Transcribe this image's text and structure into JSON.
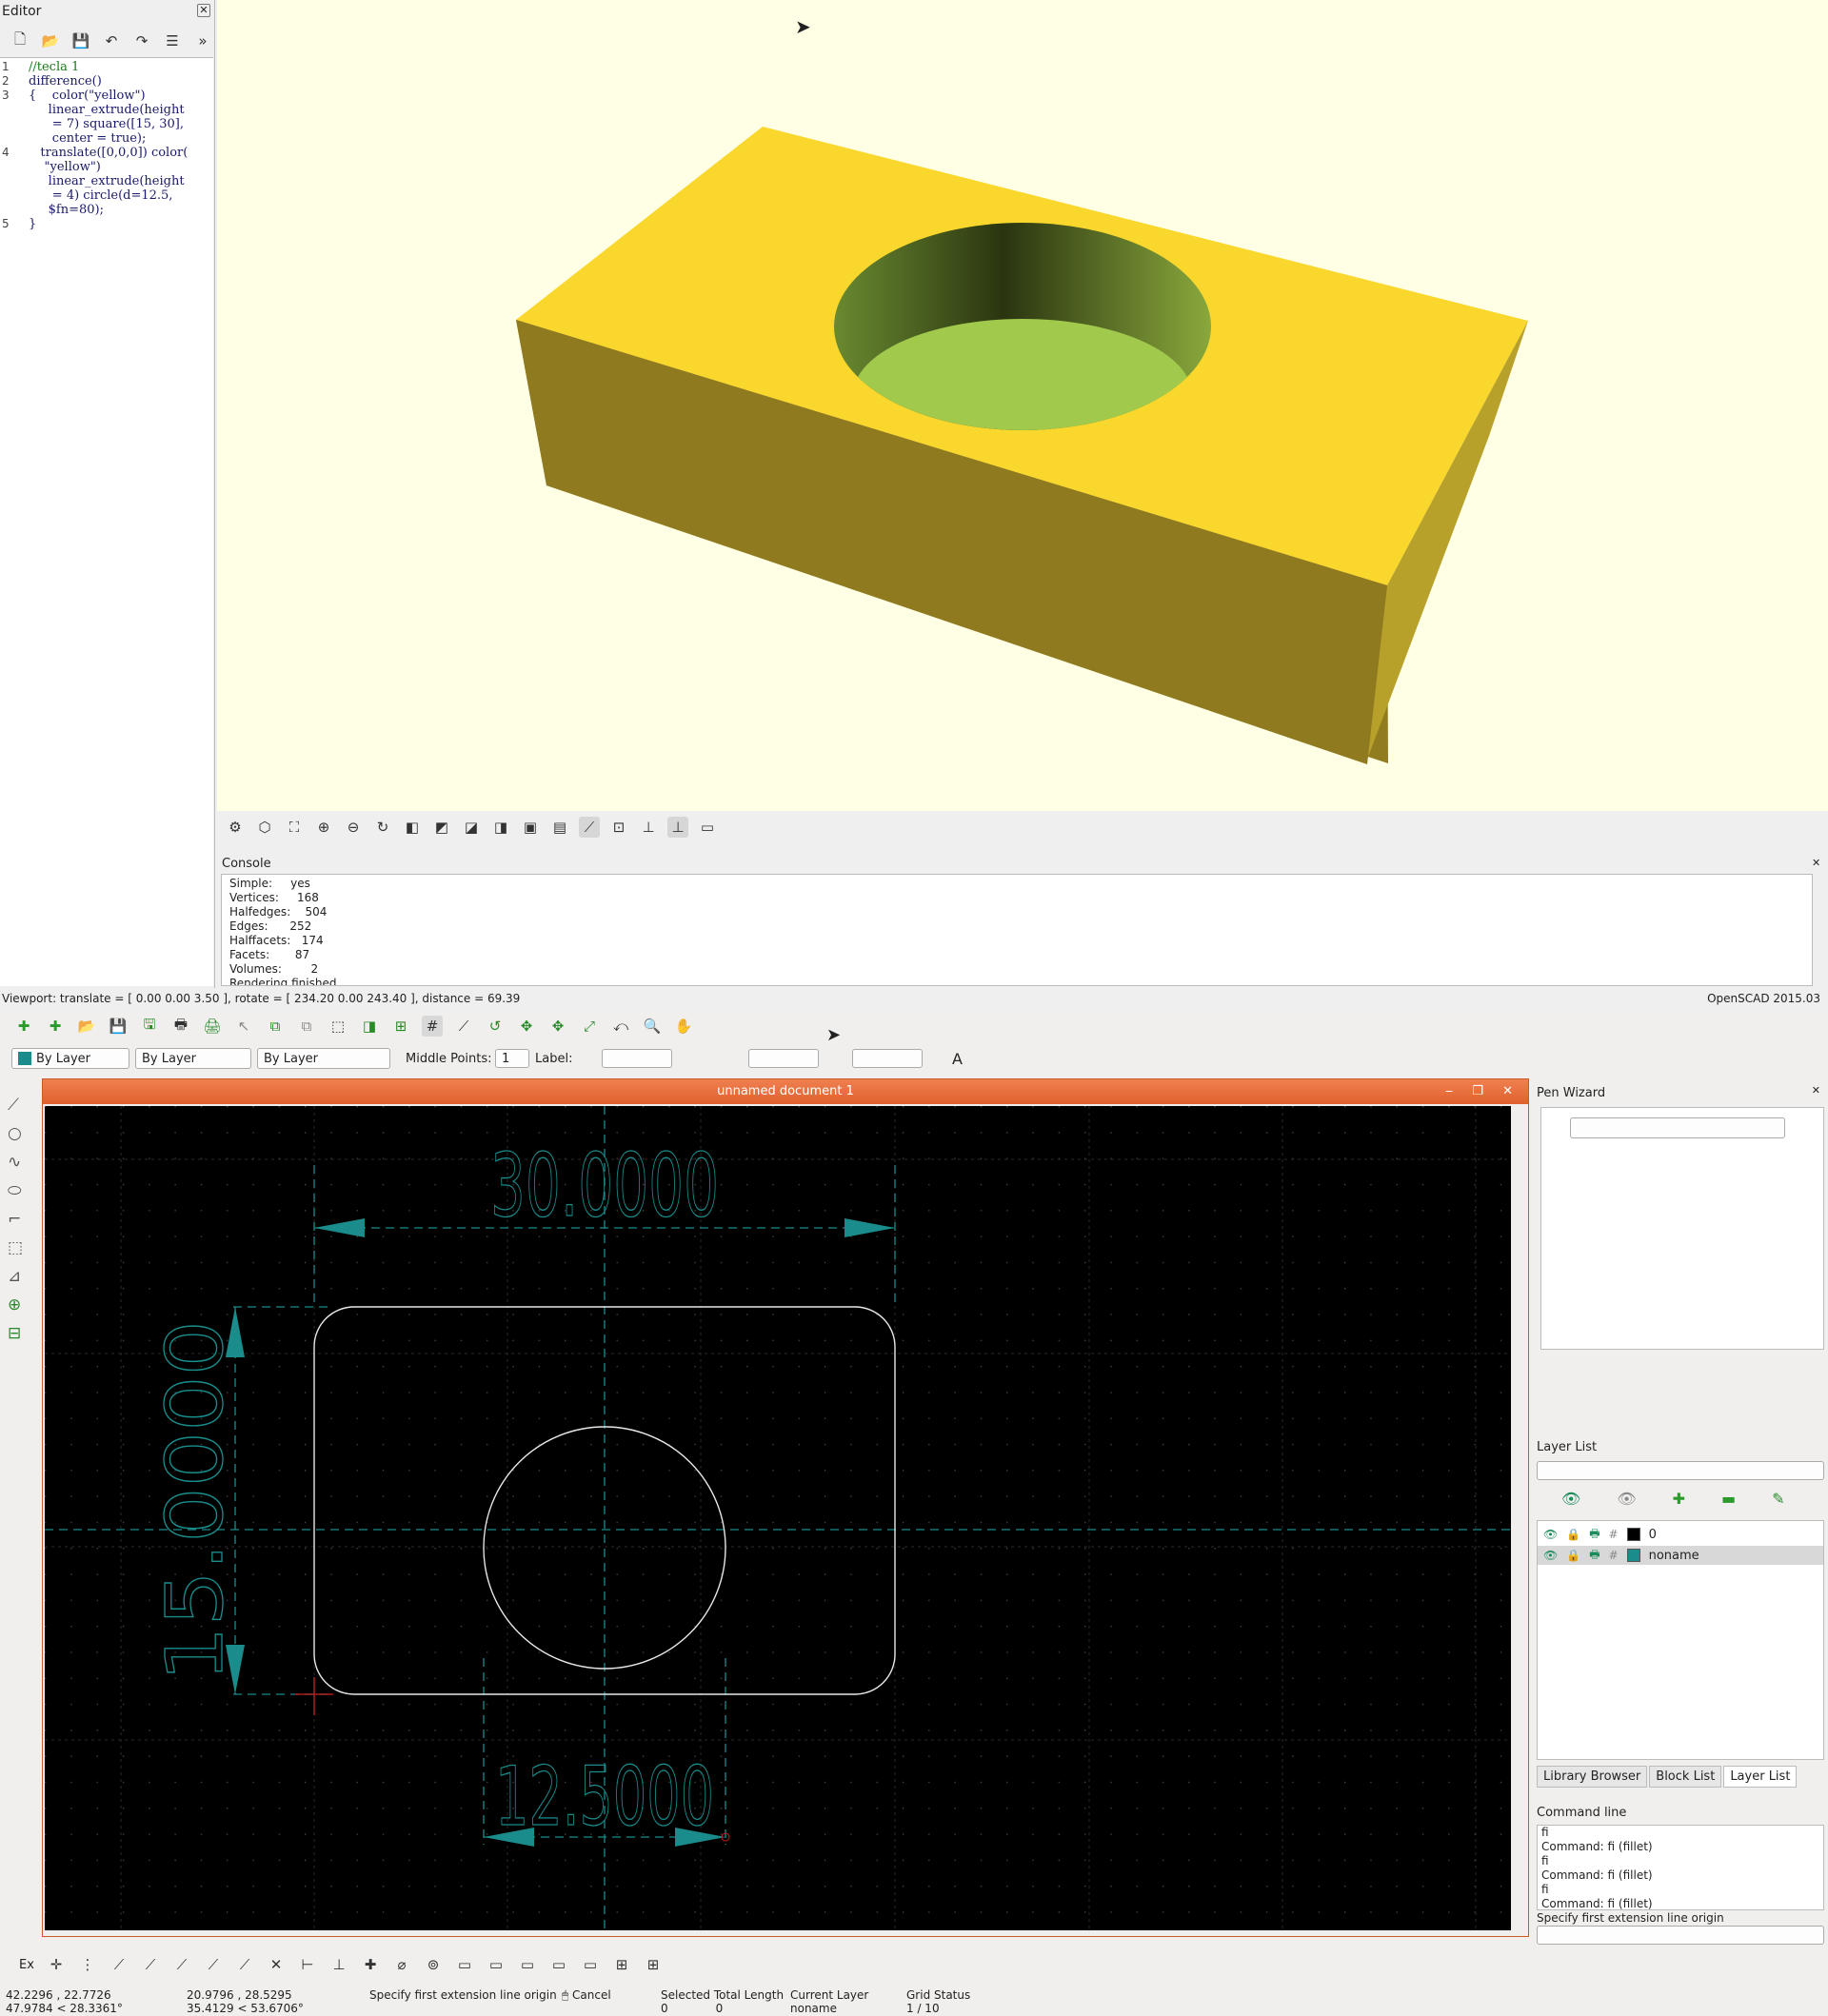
{
  "openscad": {
    "editor": {
      "title": "Editor",
      "code_lines": [
        {
          "num": "1",
          "text": "//tecla 1"
        },
        {
          "num": "2",
          "text": "difference()"
        },
        {
          "num": "3",
          "text": "{    color(\"yellow\")"
        },
        {
          "num": "",
          "text": "     linear_extrude(height"
        },
        {
          "num": "",
          "text": "      = 7) square([15, 30],"
        },
        {
          "num": "",
          "text": "      center = true);"
        },
        {
          "num": "4",
          "text": "   translate([0,0,0]) color("
        },
        {
          "num": "",
          "text": "    \"yellow\")"
        },
        {
          "num": "",
          "text": "     linear_extrude(height"
        },
        {
          "num": "",
          "text": "      = 4) circle(d=12.5,"
        },
        {
          "num": "",
          "text": "     $fn=80);"
        },
        {
          "num": "5",
          "text": "}"
        }
      ]
    },
    "console": {
      "title": "Console",
      "lines": [
        "Simple:     yes",
        "Vertices:     168",
        "Halfedges:    504",
        "Edges:      252",
        "Halffacets:   174",
        "Facets:       87",
        "Volumes:        2",
        "Rendering finished."
      ]
    },
    "status_left": "Viewport: translate = [ 0.00 0.00 3.50 ], rotate = [ 234.20 0.00 243.40 ], distance = 69.39",
    "status_right": "OpenSCAD 2015.03",
    "colors": {
      "viewport_bg": "#ffffe5",
      "model_top": "#f9d72c",
      "model_side": "#8f7a1f",
      "hole_floor": "#a1c94c"
    }
  },
  "librecad": {
    "pen": {
      "color": "By Layer",
      "width": "By Layer",
      "type": "By Layer"
    },
    "middle_points_label": "Middle Points:",
    "middle_points_value": "1",
    "label_label": "Label:",
    "document_title": "unnamed document 1",
    "dimensions": {
      "width": "30.0000",
      "height": "15.0000",
      "diameter": "12.5000"
    },
    "pen_wizard_title": "Pen Wizard",
    "layer_list_title": "Layer List",
    "layers": [
      {
        "name": "0",
        "color": "#000000"
      },
      {
        "name": "noname",
        "color": "#1a8c8c"
      }
    ],
    "tabs": [
      "Library Browser",
      "Block List",
      "Layer List"
    ],
    "command_line_title": "Command line",
    "command_history": [
      "fi",
      "Command: fi (fillet)",
      "fi",
      "Command: fi (fillet)",
      "fi",
      "Command: fi (fillet)"
    ],
    "command_prompt": "Specify first extension line origin",
    "ex_label": "Ex",
    "status": {
      "abs_coord": "42.2296 , 22.7726",
      "abs_polar": "47.9784 < 28.3361°",
      "rel_coord": "20.9796 , 28.5295",
      "rel_polar": "35.4129 < 53.6706°",
      "prompt": "Specify first extension line origin",
      "cancel": "Cancel",
      "selected_label": "Selected Total Length",
      "selected_count": "0",
      "selected_length": "0",
      "current_layer_label": "Current Layer",
      "current_layer": "noname",
      "grid_label": "Grid Status",
      "grid_value": "1 / 10"
    },
    "colors": {
      "canvas_bg": "#000000",
      "dim_color": "#1a8c8c",
      "geometry": "#e8e8e8",
      "titlebar": "#e8683a"
    }
  }
}
